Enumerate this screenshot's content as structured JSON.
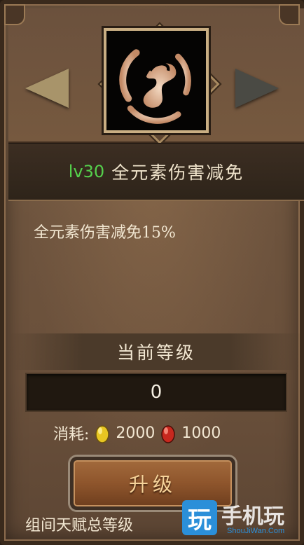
{
  "skill": {
    "level": "lv30",
    "name": "全元素伤害减免",
    "description": "全元素伤害减免15%",
    "icon": "flame-swirl-icon"
  },
  "current_level": {
    "label": "当前等级",
    "value": "0"
  },
  "cost": {
    "label": "消耗:",
    "gold_amount": "2000",
    "red_amount": "1000"
  },
  "upgrade_button": {
    "label": "升级"
  },
  "footer": {
    "text": "组间天赋总等级"
  },
  "watermark": {
    "logo_char": "玩",
    "brand": "手机玩",
    "site": "ShouJiWan.Com"
  },
  "colors": {
    "level_green": "#55d04c",
    "panel_brown": "#6e543e",
    "button_orange": "#8e552c",
    "gold_gem": "#e8c622",
    "red_gem": "#c8281e"
  }
}
